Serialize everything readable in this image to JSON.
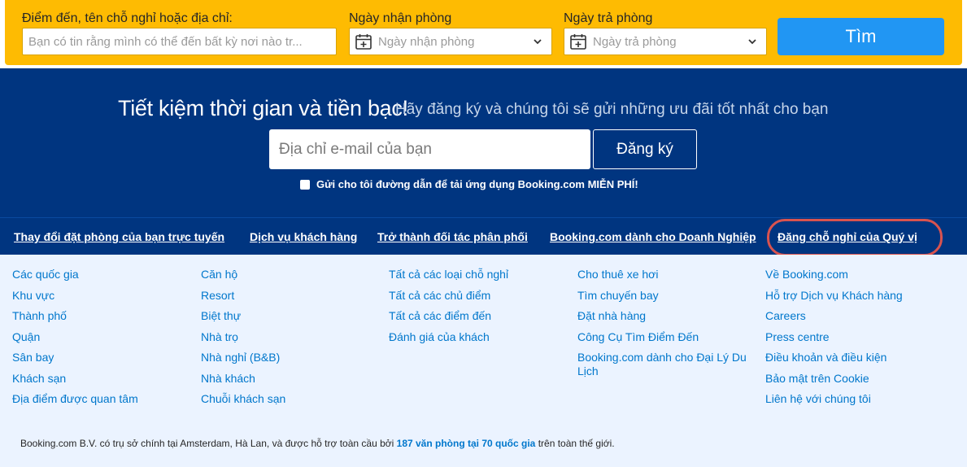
{
  "search": {
    "destination_label": "Điểm đến, tên chỗ nghỉ hoặc địa chỉ:",
    "destination_placeholder": "Bạn có tin rằng mình có thể đến bất kỳ nơi nào tr...",
    "checkin_label": "Ngày nhận phòng",
    "checkin_placeholder": "Ngày nhận phòng",
    "checkout_label": "Ngày trả phòng",
    "checkout_placeholder": "Ngày trả phòng",
    "search_button": "Tìm",
    "accent_color": "#febb02",
    "button_color": "#2196f3"
  },
  "newsletter": {
    "heading": "Tiết kiệm thời gian và tiền bạc!",
    "subheading": "Hãy đăng ký và chúng tôi sẽ gửi những ưu đãi tốt nhất cho bạn",
    "email_placeholder": "Địa chỉ e-mail của bạn",
    "subscribe_button": "Đăng ký",
    "app_link_label": "Gửi cho tôi đường dẫn để tải ứng dụng Booking.com MIỄN PHÍ!",
    "background_color": "#003580"
  },
  "links_bar": {
    "items": [
      "Thay đổi đặt phòng của bạn trực tuyến",
      "Dịch vụ khách hàng",
      "Trở thành đối tác phân phối",
      "Booking.com dành cho Doanh Nghiệp",
      "Đăng chỗ nghỉ của Quý vị"
    ],
    "highlight_color": "#d9534f"
  },
  "footer": {
    "columns": [
      [
        "Các quốc gia",
        "Khu vực",
        "Thành phố",
        "Quận",
        "Sân bay",
        "Khách sạn",
        "Địa điểm được quan tâm"
      ],
      [
        "Căn hộ",
        "Resort",
        "Biệt thự",
        "Nhà trọ",
        "Nhà nghỉ (B&B)",
        "Nhà khách",
        "Chuỗi khách sạn"
      ],
      [
        "Tất cả các loại chỗ nghỉ",
        "Tất cả các chủ điểm",
        "Tất cả các điểm đến",
        "Đánh giá của khách"
      ],
      [
        "Cho thuê xe hơi",
        "Tìm chuyến bay",
        "Đặt nhà hàng",
        "Công Cụ Tìm Điểm Đến",
        "Booking.com dành cho Đại Lý Du Lịch"
      ],
      [
        "Về Booking.com",
        "Hỗ trợ Dịch vụ Khách hàng",
        "Careers",
        "Press centre",
        "Điều khoản và điều kiện",
        "Bảo mật trên Cookie",
        "Liên hệ với chúng tôi"
      ]
    ],
    "copyright_before": "Booking.com B.V. có trụ sở chính tại Amsterdam, Hà Lan, và được hỗ trợ toàn cầu bởi",
    "copyright_highlight": "187 văn phòng tại 70 quốc gia",
    "copyright_after": "trên toàn thế giới.",
    "link_color": "#0077cc"
  }
}
